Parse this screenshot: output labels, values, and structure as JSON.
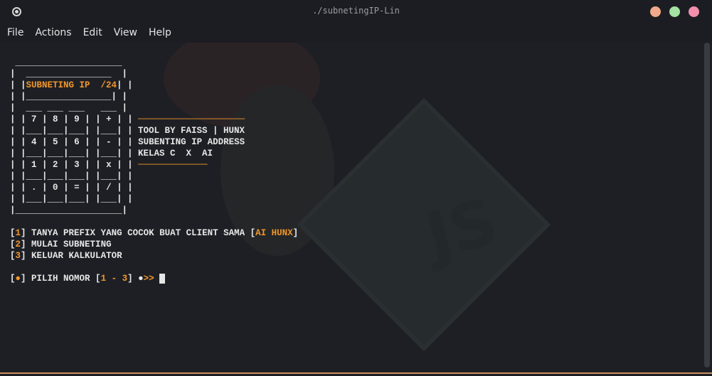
{
  "window": {
    "title": "./subnetingIP-Lin",
    "buttons": [
      {
        "name": "minimize",
        "color": "#f0a98a"
      },
      {
        "name": "maximize",
        "color": "#a4e3a1"
      },
      {
        "name": "close",
        "color": "#f28fad"
      }
    ]
  },
  "menu": [
    "File",
    "Actions",
    "Edit",
    "View",
    "Help"
  ],
  "terminal": {
    "accent_color": "#f0972a",
    "calc_display": "SUBNETING IP  /24",
    "calc_keys": [
      "7",
      "8",
      "9",
      "+",
      "4",
      "5",
      "6",
      "-",
      "1",
      "2",
      "3",
      "x",
      ".",
      "0",
      "=",
      "/"
    ],
    "info_lines": [
      "TOOL BY FAISS | HUNX",
      "SUBENTING IP ADDRESS",
      "KELAS C  X  AI"
    ],
    "menu_options": [
      {
        "num": "1",
        "text": "TANYA PREFIX YANG COCOK BUAT CLIENT SAMA [",
        "highlight": "AI HUNX",
        "tail": "]"
      },
      {
        "num": "2",
        "text": "MULAI SUBNETING"
      },
      {
        "num": "3",
        "text": "KELUAR KALKULATOR"
      }
    ],
    "prompt": {
      "marker": "●",
      "label": "PILIH NOMOR [",
      "range": "1 - 3",
      "close": "]",
      "arrow_dot": "●",
      "arrow": ">>"
    }
  }
}
